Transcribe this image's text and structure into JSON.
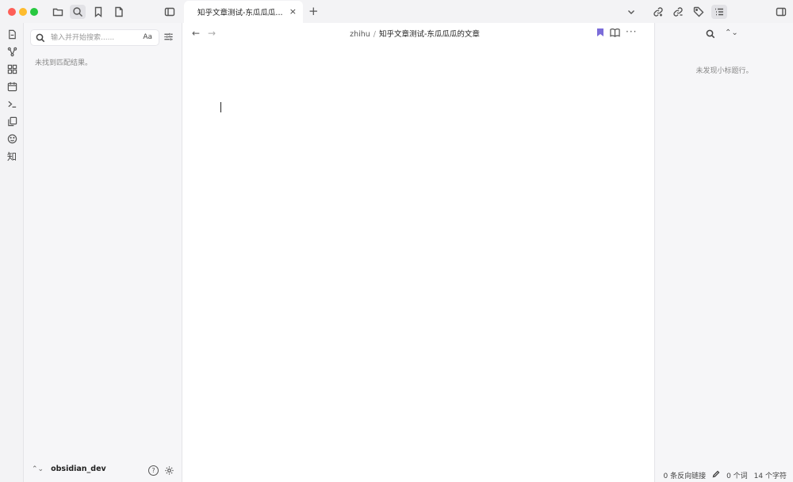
{
  "window": {
    "tab_title": "知乎文章测试-东瓜瓜瓜...",
    "tab_close": "×",
    "new_tab": "+"
  },
  "titlebar_icons": [
    "folder-icon",
    "search-icon",
    "bookmark-icon",
    "file-icon",
    "sidebar-toggle-icon",
    "chevron-down-icon",
    "link-icon",
    "unlink-icon",
    "tag-icon",
    "outline-list-icon",
    "right-sidebar-toggle-icon"
  ],
  "ribbon": {
    "items": [
      "open-file-icon",
      "graph-view-icon",
      "canvas-icon",
      "calendar-icon",
      "terminal-icon",
      "copy-icon",
      "emoji-icon"
    ],
    "zhihu_label": "知"
  },
  "search": {
    "placeholder": "输入并开始搜索......",
    "value": "",
    "match_case_label": "Aa",
    "no_results": "未找到匹配结果。"
  },
  "vault": {
    "name": "obsidian_dev",
    "chevron": "⌃⌄",
    "help": "?"
  },
  "editor": {
    "back": "←",
    "forward": "→",
    "breadcrumb_folder": "zhihu",
    "breadcrumb_sep": "/",
    "breadcrumb_file": "知乎文章测试-东瓜瓜瓜的文章",
    "more": "···",
    "bookmark_color": "#7b6cd9",
    "content": ""
  },
  "outline": {
    "collapse": "⌃⌄",
    "empty_message": "未发现小标题行。"
  },
  "status": {
    "backlinks": "0 条反向链接",
    "words": "0 个词",
    "chars": "14 个字符"
  }
}
